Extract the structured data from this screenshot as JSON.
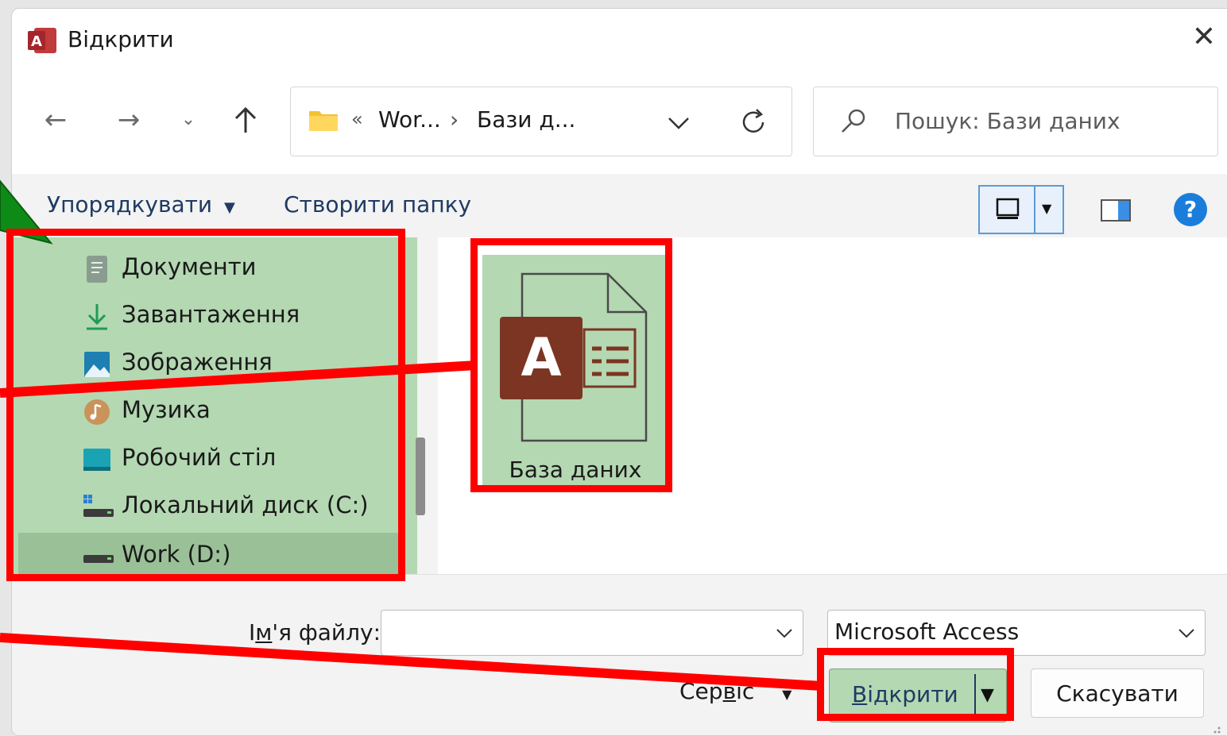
{
  "window": {
    "title": "Відкрити"
  },
  "address": {
    "overflow": "«",
    "crumbs": [
      "Wor...",
      "Бази д..."
    ],
    "separator": "›"
  },
  "search": {
    "placeholder": "Пошук: Бази даних"
  },
  "toolbar": {
    "organize": "Упорядкувати",
    "new_folder": "Створити папку",
    "help": "?"
  },
  "nav": {
    "items": [
      {
        "label": "Документи",
        "icon": "documents-icon"
      },
      {
        "label": "Завантаження",
        "icon": "download-icon"
      },
      {
        "label": "Зображення",
        "icon": "pictures-icon"
      },
      {
        "label": "Музика",
        "icon": "music-icon"
      },
      {
        "label": "Робочий стіл",
        "icon": "desktop-icon"
      },
      {
        "label": "Локальний диск (C:)",
        "icon": "drive-c-icon"
      },
      {
        "label": "Work (D:)",
        "icon": "drive-d-icon"
      }
    ]
  },
  "files": [
    {
      "name": "База даних",
      "icon": "access-database-icon",
      "glyph": "A"
    }
  ],
  "filename": {
    "label_pre": "І",
    "label_underline": "м",
    "label_post": "'я файлу:",
    "value": ""
  },
  "filetype": {
    "selected": "Microsoft Access"
  },
  "buttons": {
    "service_pre": "Сер",
    "service_underline": "в",
    "service_post": "іс",
    "open_underline": "В",
    "open_rest": "ідкрити",
    "cancel": "Скасувати"
  },
  "colors": {
    "highlight": "#b4d8b2",
    "annotation": "#ff0000",
    "arrow": "#0e8a16",
    "access": "#7b3522",
    "link": "#1f3b63"
  }
}
